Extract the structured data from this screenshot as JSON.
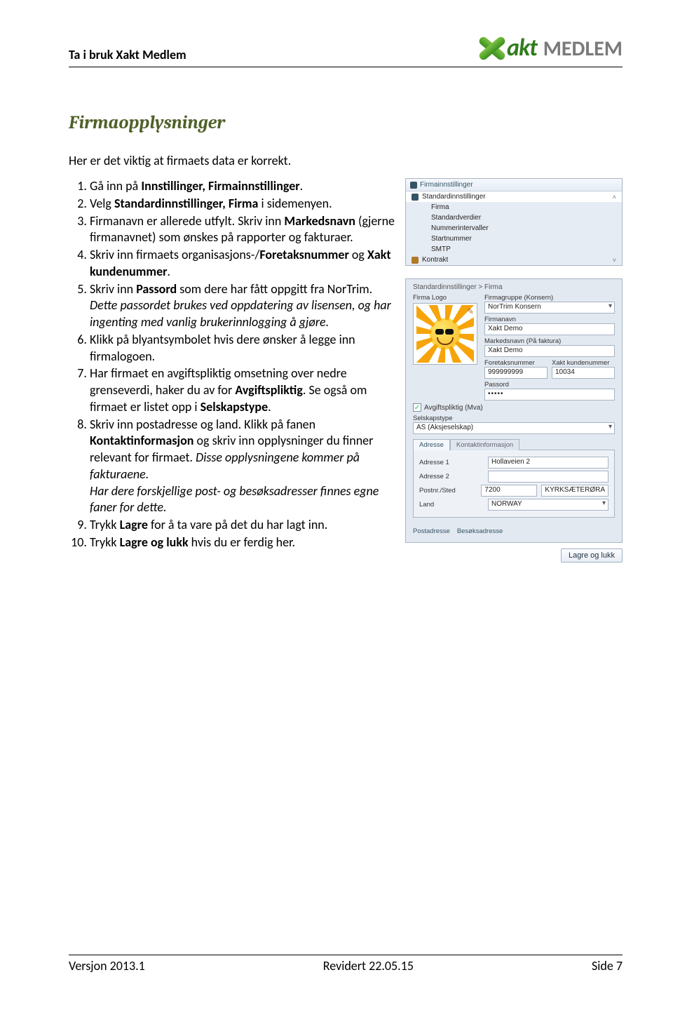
{
  "header": {
    "title": "Ta i bruk Xakt Medlem",
    "brand_akt": "akt",
    "brand_medlem": " MEDLEM"
  },
  "section_title": "Firmaopplysninger",
  "lead": "Her er det viktig at firmaets data er korrekt.",
  "steps": {
    "s1a": "Gå inn på ",
    "s1b": "Innstillinger, Firmainnstillinger",
    "s1c": ".",
    "s2a": "Velg ",
    "s2b": "Standardinnstillinger, Firma",
    "s2c": " i sidemenyen.",
    "s3a": "Firmanavn er allerede utfylt. Skriv inn ",
    "s3b": "Markedsnavn",
    "s3c": " (gjerne firmanavnet) som ønskes på rapporter og fakturaer.",
    "s4a": "Skriv inn firmaets organisasjons-/",
    "s4b": "Foretaksnummer",
    "s4c": " og ",
    "s4d": "Xakt kundenummer",
    "s4e": ".",
    "s5a": "Skriv inn ",
    "s5b": "Passord",
    "s5c": " som dere har fått oppgitt fra NorTrim. ",
    "s5d": "Dette passordet brukes ved oppdatering av lisensen, og har ingenting med vanlig brukerinnlogging å gjøre.",
    "s6": "Klikk på blyantsymbolet hvis dere ønsker å legge inn firmalogoen.",
    "s7a": "Har firmaet en avgiftspliktig omsetning over nedre grenseverdi, haker du av for ",
    "s7b": "Avgiftspliktig",
    "s7c": ". Se også om firmaet er listet opp i ",
    "s7d": "Selskapstype",
    "s7e": ".",
    "s8a": "Skriv inn postadresse og land. Klikk på fanen ",
    "s8b": "Kontaktinformasjon",
    "s8c": " og skriv inn opplysninger du finner relevant for firmaet. ",
    "s8d": "Disse opplysningene kommer på fakturaene.",
    "s8e": "Har dere forskjellige post- og besøksadresser finnes egne faner for dette.",
    "s9a": "Trykk ",
    "s9b": "Lagre",
    "s9c": " for å ta vare på det du har lagt inn.",
    "s10a": "Trykk ",
    "s10b": "Lagre og lukk",
    "s10c": " hvis du er ferdig her."
  },
  "screenshot": {
    "panel_title": "Firmainnstillinger",
    "tree": {
      "root": "Standardinnstillinger",
      "items": [
        "Firma",
        "Standardverdier",
        "Nummerintervaller",
        "Startnummer",
        "SMTP"
      ],
      "kontrakt": "Kontrakt"
    },
    "form": {
      "crumb": "Standardinnstillinger > Firma",
      "firma_logo": "Firma Logo",
      "firmagruppe": "Firmagruppe (Konsern)",
      "firmagruppe_val": "NorTrim Konsern",
      "firmanavn": "Firmanavn",
      "firmanavn_val": "Xakt Demo",
      "markedsnavn": "Markedsnavn (På faktura)",
      "markedsnavn_val": "Xakt Demo",
      "foretaksnummer": "Foretaksnummer",
      "foretaksnummer_val": "999999999",
      "xakt_kunde": "Xakt kundenummer",
      "xakt_kunde_val": "10034",
      "passord": "Passord",
      "passord_val": "•••••",
      "avgift": "Avgiftspliktig (Mva)",
      "selskapstype": "Selskapstype",
      "selskapstype_val": "AS (Aksjeselskap)",
      "tab_adresse": "Adresse",
      "tab_kontakt": "Kontaktinformasjon",
      "adresse1": "Adresse 1",
      "adresse1_val": "Hollaveien 2",
      "adresse2": "Adresse 2",
      "postnr": "Postnr./Sted",
      "postnr_val": "7200",
      "sted_val": "KYRKSÆTERØRA",
      "land": "Land",
      "land_val": "NORWAY",
      "footer_tab1": "Postadresse",
      "footer_tab2": "Besøksadresse",
      "save_btn": "Lagre og lukk"
    }
  },
  "footer": {
    "version": "Versjon 2013.1",
    "revised": "Revidert 22.05.15",
    "page": "Side 7"
  }
}
